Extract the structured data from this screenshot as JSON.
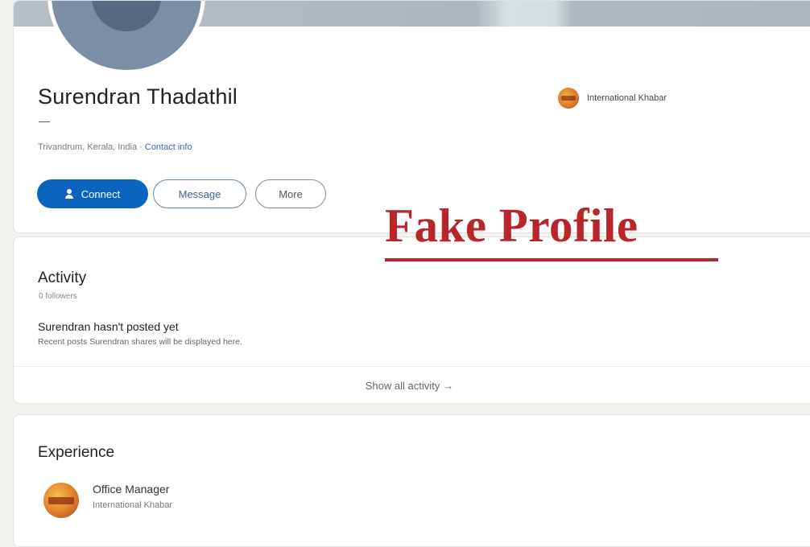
{
  "profile": {
    "name": "Surendran Thadathil",
    "headline": "—",
    "location": "Trivandrum, Kerala, India ·",
    "contact_info": "Contact info",
    "current_org": "International Khabar",
    "buttons": {
      "connect": "Connect",
      "message": "Message",
      "more": "More"
    }
  },
  "activity": {
    "title": "Activity",
    "followers": "0 followers",
    "empty_title": "Surendran hasn't posted yet",
    "empty_desc": "Recent posts Surendran shares will be displayed here.",
    "show_all": "Show all activity",
    "show_all_icon": "→"
  },
  "experience": {
    "title": "Experience",
    "items": [
      {
        "role": "Office Manager",
        "org": "International Khabar"
      }
    ]
  },
  "overlay": {
    "text": "Fake Profile",
    "color": "#b8262a"
  },
  "colors": {
    "primary": "#0a64bd",
    "background": "#f3f2ef"
  }
}
